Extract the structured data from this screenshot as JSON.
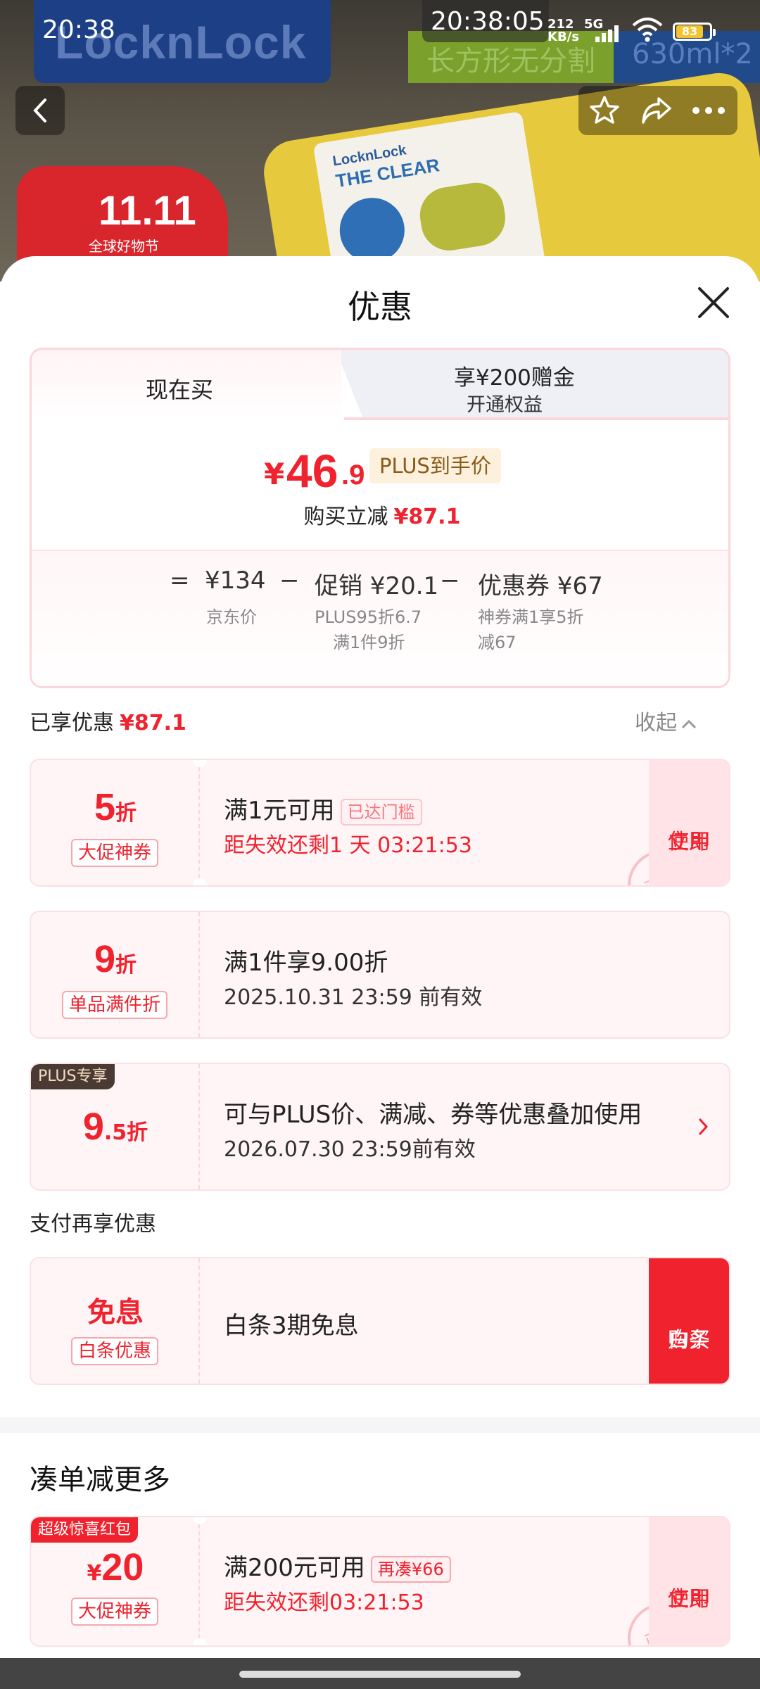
{
  "status_bar": {
    "time_left": "20:38",
    "time_center": "20:38:05",
    "net_speed_value": "212",
    "net_speed_unit": "KB/s",
    "signal": "5G",
    "battery": "83"
  },
  "background": {
    "brand_text": "LocknLock",
    "tag1": "长方形无分割",
    "tag2": "630ml*2",
    "box_brand": "LocknLock",
    "box_series": "THE CLEAR",
    "badge_top": "11.11",
    "badge_bottom": "全球好物节"
  },
  "sheet": {
    "title": "优惠",
    "tabs": {
      "now": "现在买",
      "plus_title": "享¥200赠金",
      "plus_sub": "开通权益"
    },
    "price": {
      "currency": "¥",
      "integer": "46",
      "decimal": ".9",
      "plus_label": "PLUS到手价"
    },
    "save": {
      "label": "购买立减",
      "amount": "¥87.1"
    },
    "breakdown": {
      "eq": "=",
      "jd_price": "¥134",
      "jd_label": "京东价",
      "minus1": "−",
      "promo": "促销 ¥20.1",
      "promo_sub1": "PLUS95折6.7",
      "promo_sub2": "满1件9折",
      "minus2": "−",
      "coupon": "优惠券 ¥67",
      "coupon_sub1": "神券满1享5折",
      "coupon_sub2": "减67"
    },
    "enjoyed": {
      "label": "已享优惠",
      "amount": "¥87.1",
      "collapse": "收起"
    },
    "coupons": [
      {
        "num": "5",
        "unit": "折",
        "tag": "大促神券",
        "title": "满1元可用",
        "chip": "已达门槛",
        "sub": "距失效还剩1 天 03:21:53",
        "action_l1": "立即",
        "action_l2": "使用",
        "stamp": "已领"
      },
      {
        "num": "9",
        "unit": "折",
        "tag": "单品满件折",
        "title": "满1件享9.00折",
        "sub": "2025.10.31 23:59 前有效"
      },
      {
        "corner": "PLUS专享",
        "num": "9",
        "num_dec": ".5",
        "unit": "折",
        "title": "可与PLUS价、满减、券等优惠叠加使用",
        "sub": "2026.07.30 23:59前有效"
      }
    ],
    "pay": {
      "title": "支付再享优惠",
      "big": "免息",
      "tag": "白条优惠",
      "text": "白条3期免息",
      "action_l1": "白条",
      "action_l2": "购买"
    },
    "more": {
      "title": "凑单减更多",
      "corner": "超级惊喜红包",
      "cur": "¥",
      "num": "20",
      "tag": "大促神券",
      "title2": "满200元可用",
      "chip": "再凑¥66",
      "sub": "距失效还剩03:21:53",
      "action_l1": "立即",
      "action_l2": "使用",
      "stamp": "已领"
    }
  },
  "colors": {
    "accent": "#f0222e",
    "card_bg": "#fff5f6",
    "plus_chip_bg": "#fdf0dc"
  }
}
